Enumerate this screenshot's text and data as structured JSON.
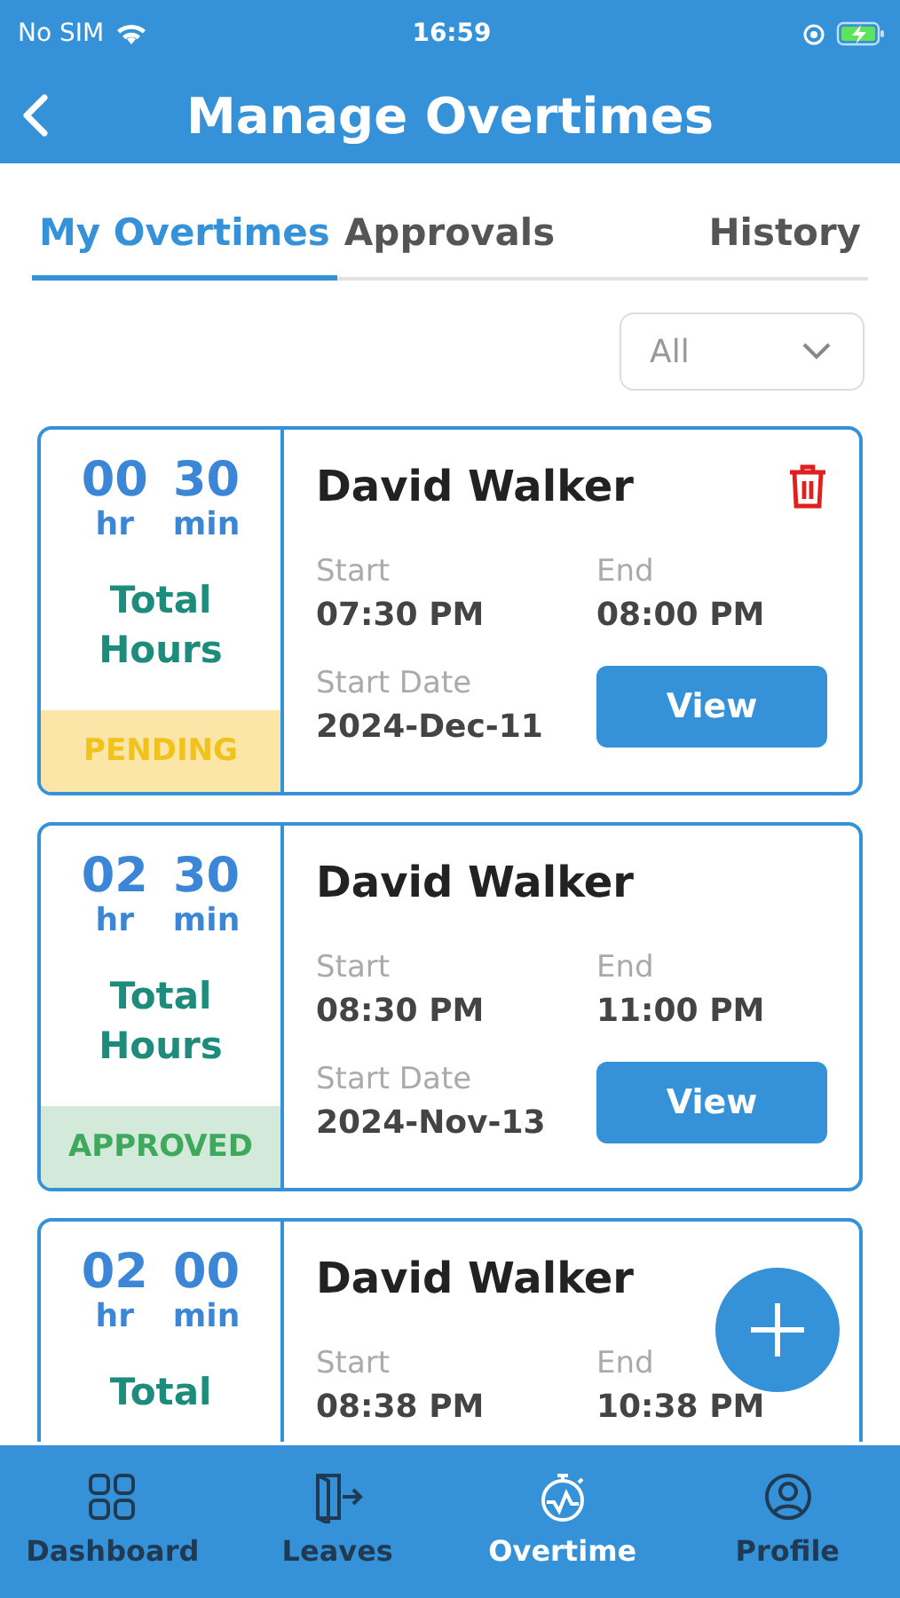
{
  "status_bar": {
    "carrier": "No SIM",
    "time": "16:59"
  },
  "header": {
    "title": "Manage Overtimes"
  },
  "tabs": [
    {
      "label": "My Overtimes",
      "selected": true
    },
    {
      "label": "Approvals",
      "selected": false
    },
    {
      "label": "History",
      "selected": false
    }
  ],
  "filter": {
    "value": "All"
  },
  "overtimes": [
    {
      "hours": "00",
      "hr_unit": "hr",
      "minutes": "30",
      "min_unit": "min",
      "total_label": "Total Hours",
      "status": {
        "label": "PENDING",
        "kind": "pending"
      },
      "name": "David Walker",
      "start_label": "Start",
      "start": "07:30 PM",
      "end_label": "End",
      "end": "08:00 PM",
      "date_label": "Start Date",
      "date": "2024-Dec-11",
      "button": "View",
      "deletable": true
    },
    {
      "hours": "02",
      "hr_unit": "hr",
      "minutes": "30",
      "min_unit": "min",
      "total_label": "Total Hours",
      "status": {
        "label": "APPROVED",
        "kind": "approved"
      },
      "name": "David Walker",
      "start_label": "Start",
      "start": "08:30 PM",
      "end_label": "End",
      "end": "11:00 PM",
      "date_label": "Start Date",
      "date": "2024-Nov-13",
      "button": "View",
      "deletable": false
    },
    {
      "hours": "02",
      "hr_unit": "hr",
      "minutes": "00",
      "min_unit": "min",
      "total_label": "Total",
      "name": "David Walker",
      "start_label": "Start",
      "start": "08:38 PM",
      "end_label": "End",
      "end": "10:38 PM",
      "deletable": false
    }
  ],
  "bottom_nav": [
    {
      "label": "Dashboard",
      "kind": "grid",
      "selected": false
    },
    {
      "label": "Leaves",
      "kind": "exit",
      "selected": false
    },
    {
      "label": "Overtime",
      "kind": "stopwatch",
      "selected": true
    },
    {
      "label": "Profile",
      "kind": "person",
      "selected": false
    }
  ]
}
